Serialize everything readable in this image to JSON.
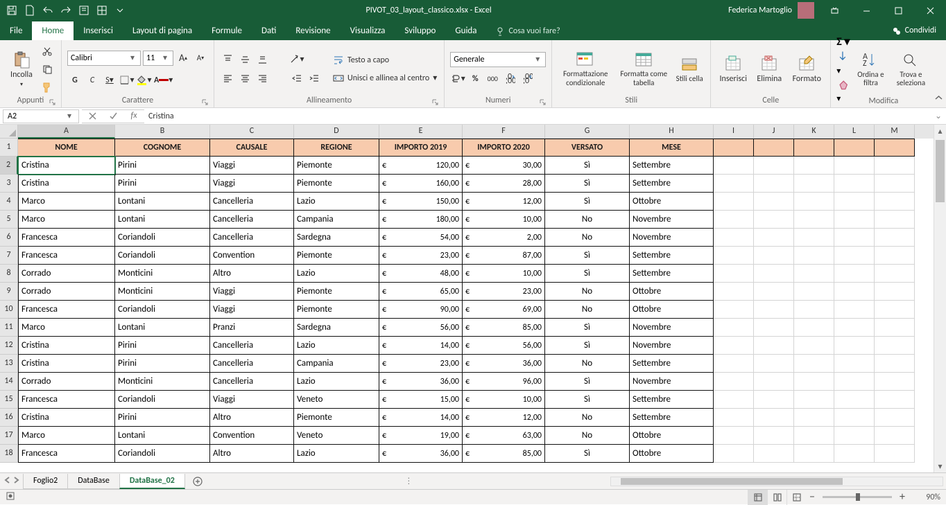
{
  "app": {
    "title": "PIVOT_03_layout_classico.xlsx - Excel",
    "user": "Federica Martoglio"
  },
  "tabs": {
    "items": [
      "File",
      "Home",
      "Inserisci",
      "Layout di pagina",
      "Formule",
      "Dati",
      "Revisione",
      "Visualizza",
      "Sviluppo",
      "Guida"
    ],
    "active": "Home",
    "tellme": "Cosa vuoi fare?",
    "share": "Condividi"
  },
  "ribbon": {
    "clipboard": {
      "paste": "Incolla",
      "label": "Appunti"
    },
    "font": {
      "name": "Calibri",
      "size": "11",
      "label": "Carattere",
      "bold": "G",
      "italic": "C",
      "underline": "S"
    },
    "align": {
      "wrap": "Testo a capo",
      "merge": "Unisci e allinea al centro",
      "label": "Allineamento"
    },
    "number": {
      "format": "Generale",
      "label": "Numeri"
    },
    "styles": {
      "cond": "Formattazione condizionale",
      "table": "Formatta come tabella",
      "cell": "Stili cella",
      "label": "Stili"
    },
    "cells": {
      "ins": "Inserisci",
      "del": "Elimina",
      "fmt": "Formato",
      "label": "Celle"
    },
    "editing": {
      "sort": "Ordina e filtra",
      "find": "Trova e seleziona",
      "label": "Modifica"
    }
  },
  "namebox": "A2",
  "formula": "Cristina",
  "cols": [
    "A",
    "B",
    "C",
    "D",
    "E",
    "F",
    "G",
    "H",
    "I",
    "J",
    "K",
    "L",
    "M"
  ],
  "headers": [
    "NOME",
    "COGNOME",
    "CAUSALE",
    "REGIONE",
    "IMPORTO 2019",
    "IMPORTO 2020",
    "VERSATO",
    "MESE"
  ],
  "rows": [
    [
      "Cristina",
      "Pirini",
      "Viaggi",
      "Piemonte",
      "120,00",
      "30,00",
      "Sì",
      "Settembre"
    ],
    [
      "Cristina",
      "Pirini",
      "Viaggi",
      "Piemonte",
      "160,00",
      "28,00",
      "Sì",
      "Settembre"
    ],
    [
      "Marco",
      "Lontani",
      "Cancelleria",
      "Lazio",
      "150,00",
      "12,00",
      "Sì",
      "Ottobre"
    ],
    [
      "Marco",
      "Lontani",
      "Cancelleria",
      "Campania",
      "180,00",
      "10,00",
      "No",
      "Novembre"
    ],
    [
      "Francesca",
      "Coriandoli",
      "Cancelleria",
      "Sardegna",
      "54,00",
      "2,00",
      "No",
      "Novembre"
    ],
    [
      "Francesca",
      "Coriandoli",
      "Convention",
      "Piemonte",
      "23,00",
      "87,00",
      "Sì",
      "Settembre"
    ],
    [
      "Corrado",
      "Monticini",
      "Altro",
      "Lazio",
      "48,00",
      "10,00",
      "Sì",
      "Settembre"
    ],
    [
      "Corrado",
      "Monticini",
      "Viaggi",
      "Piemonte",
      "65,00",
      "23,00",
      "No",
      "Ottobre"
    ],
    [
      "Francesca",
      "Coriandoli",
      "Viaggi",
      "Piemonte",
      "90,00",
      "69,00",
      "No",
      "Ottobre"
    ],
    [
      "Marco",
      "Lontani",
      "Pranzi",
      "Sardegna",
      "56,00",
      "85,00",
      "Sì",
      "Novembre"
    ],
    [
      "Cristina",
      "Pirini",
      "Cancelleria",
      "Lazio",
      "14,00",
      "56,00",
      "Sì",
      "Novembre"
    ],
    [
      "Cristina",
      "Pirini",
      "Cancelleria",
      "Campania",
      "23,00",
      "36,00",
      "No",
      "Settembre"
    ],
    [
      "Corrado",
      "Monticini",
      "Cancelleria",
      "Lazio",
      "36,00",
      "96,00",
      "Sì",
      "Novembre"
    ],
    [
      "Francesca",
      "Coriandoli",
      "Viaggi",
      "Veneto",
      "15,00",
      "10,00",
      "Sì",
      "Settembre"
    ],
    [
      "Cristina",
      "Pirini",
      "Altro",
      "Piemonte",
      "14,00",
      "12,00",
      "No",
      "Settembre"
    ],
    [
      "Marco",
      "Lontani",
      "Convention",
      "Veneto",
      "19,00",
      "63,00",
      "No",
      "Ottobre"
    ],
    [
      "Francesca",
      "Coriandoli",
      "Altro",
      "Lazio",
      "36,00",
      "85,00",
      "Sì",
      "Ottobre"
    ]
  ],
  "currency": "€",
  "sheets": {
    "items": [
      "Foglio2",
      "DataBase",
      "DataBase_02"
    ],
    "active": "DataBase_02"
  },
  "status": {
    "zoom": "90%"
  }
}
